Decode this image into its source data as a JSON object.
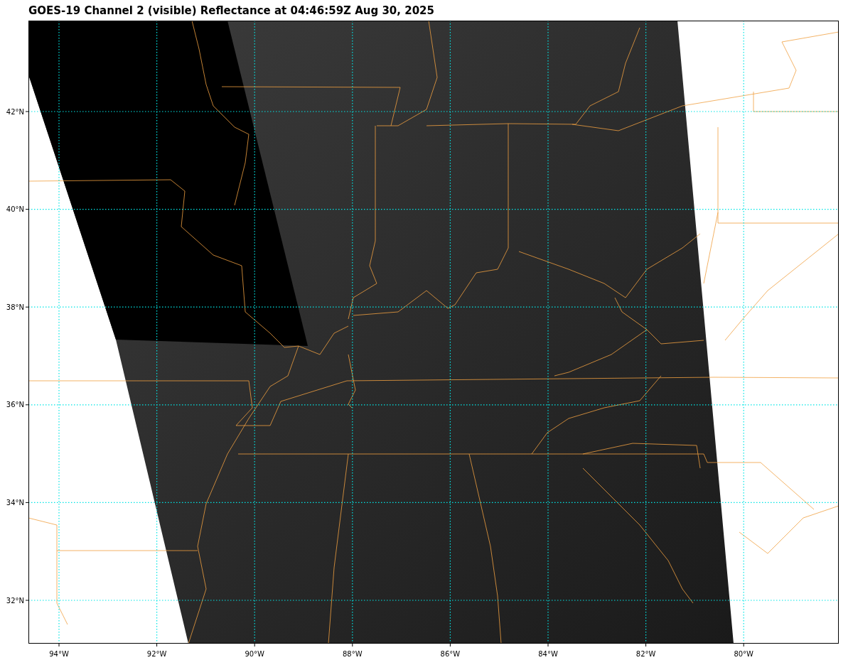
{
  "title": "GOES-19 Channel 2 (visible) Reflectance at 04:46:59Z Aug 30, 2025",
  "map": {
    "lon_labels": [
      "94°W",
      "92°W",
      "90°W",
      "88°W",
      "86°W",
      "84°W",
      "82°W",
      "80°W"
    ],
    "lat_labels": [
      "42°N",
      "40°N",
      "38°N",
      "36°N",
      "34°N",
      "32°N"
    ]
  }
}
